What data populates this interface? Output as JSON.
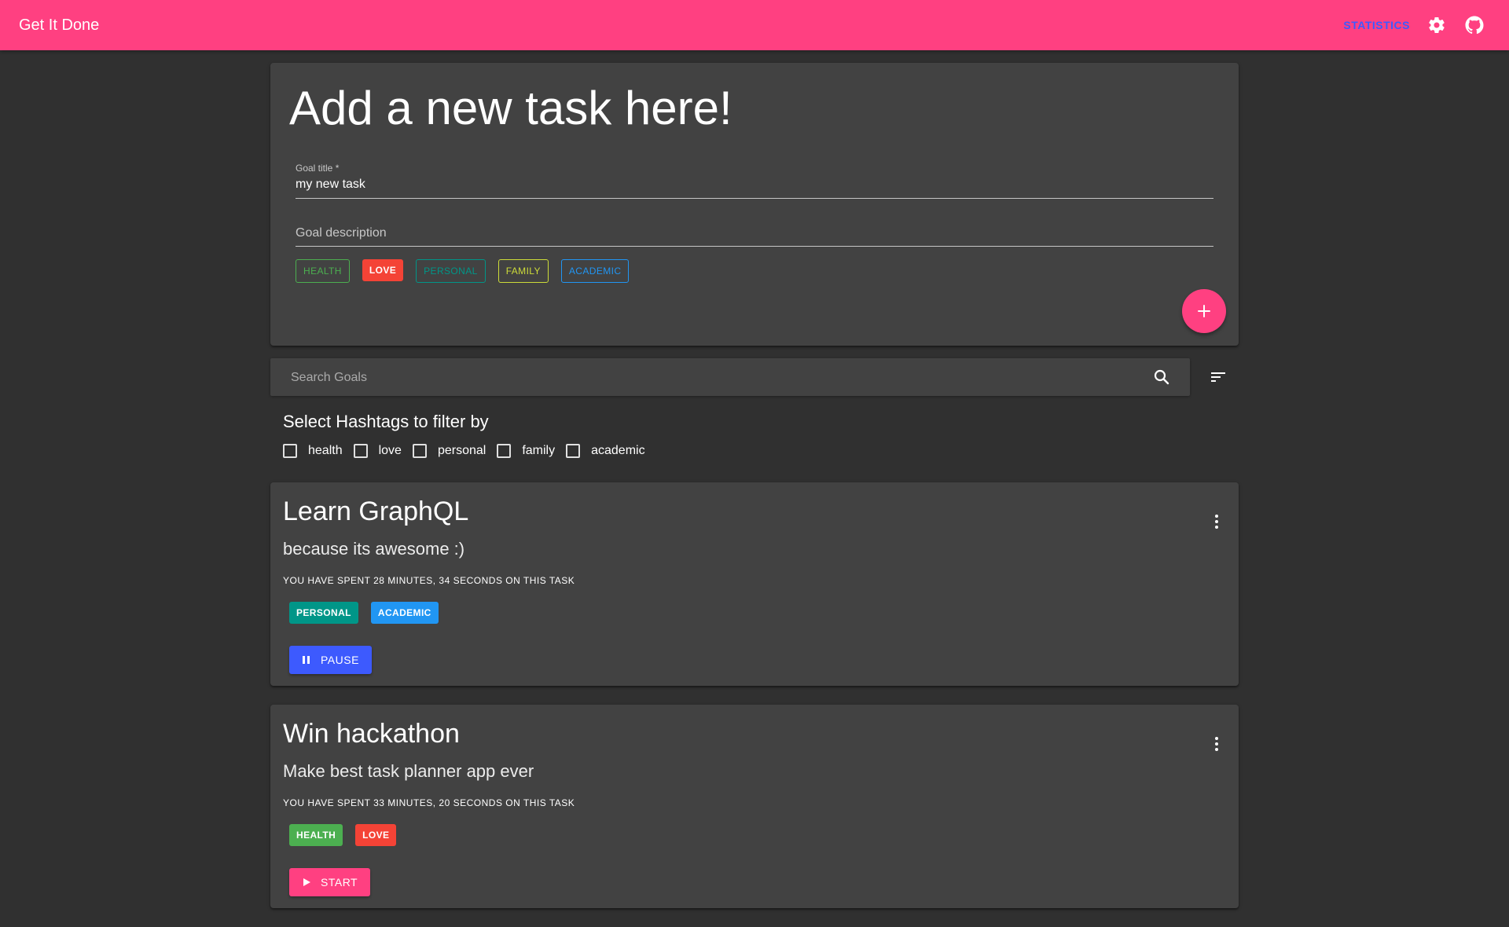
{
  "appbar": {
    "title": "Get It Done",
    "statistics_label": "STATISTICS",
    "icons": [
      "settings-icon",
      "github-icon"
    ]
  },
  "add_task": {
    "heading": "Add a new task here!",
    "goal_title_label": "Goal title *",
    "goal_title_value": "my new task",
    "goal_description_placeholder": "Goal description",
    "tags": [
      {
        "label": "HEALTH",
        "selected": false,
        "color": "#4caf50"
      },
      {
        "label": "LOVE",
        "selected": true,
        "color": "#f44336"
      },
      {
        "label": "PERSONAL",
        "selected": false,
        "color": "#009688"
      },
      {
        "label": "FAMILY",
        "selected": false,
        "color": "#cddc39"
      },
      {
        "label": "ACADEMIC",
        "selected": false,
        "color": "#2196f3"
      }
    ],
    "fab_icon": "plus-icon"
  },
  "search": {
    "placeholder": "Search Goals"
  },
  "filter": {
    "title": "Select Hashtags to filter by",
    "options": [
      "health",
      "love",
      "personal",
      "family",
      "academic"
    ]
  },
  "tasks": [
    {
      "title": "Learn GraphQL",
      "description": "because its awesome :)",
      "time_spent": "YOU HAVE SPENT 28 MINUTES, 34 SECONDS ON THIS TASK",
      "tags": [
        {
          "label": "PERSONAL",
          "color": "#009688"
        },
        {
          "label": "ACADEMIC",
          "color": "#2196f3"
        }
      ],
      "action_label": "PAUSE",
      "action_color": "#3d5afe"
    },
    {
      "title": "Win hackathon",
      "description": "Make best task planner app ever",
      "time_spent": "YOU HAVE SPENT 33 MINUTES, 20 SECONDS ON THIS TASK",
      "tags": [
        {
          "label": "HEALTH",
          "color": "#4caf50"
        },
        {
          "label": "LOVE",
          "color": "#f44336"
        }
      ],
      "action_label": "START",
      "action_color": "#ff4081"
    }
  ],
  "colors": {
    "accent": "#ff4081",
    "primary": "#3d5afe",
    "background": "#303030",
    "surface": "#424242"
  }
}
